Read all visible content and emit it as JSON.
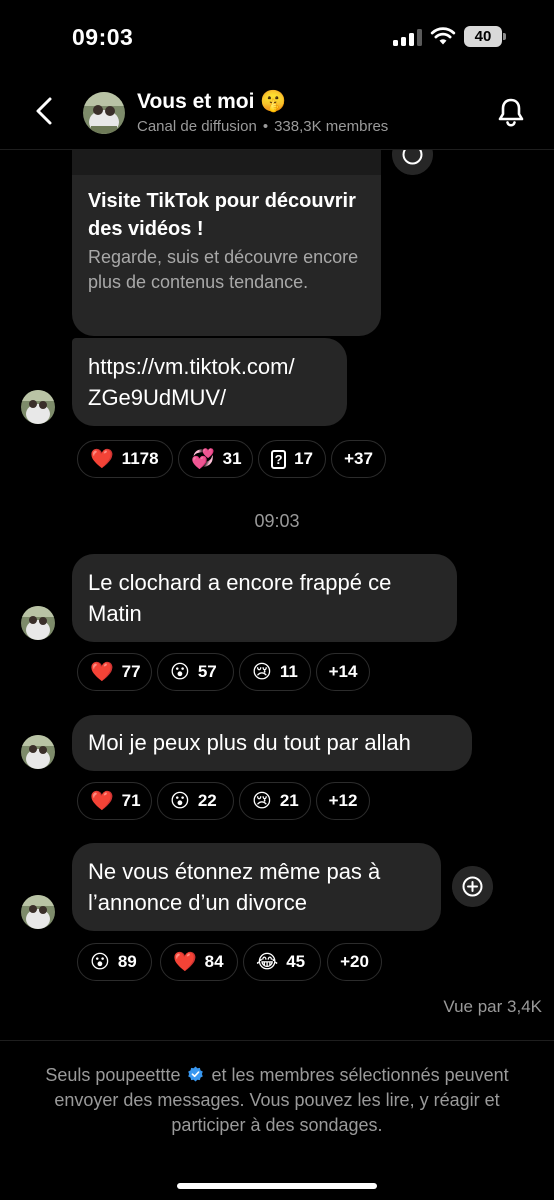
{
  "status_bar": {
    "time": "09:03",
    "battery": "40"
  },
  "header": {
    "title": "Vous et moi 🤫",
    "subtitle": "Canal de diffusion",
    "separator": "•",
    "members": "338,3K membres"
  },
  "messages": {
    "link_card": {
      "title": "Visite TikTok pour découvrir des vidéos !",
      "description": "Regarde, suis et découvre encore plus de contenus tendance."
    },
    "link": {
      "line1": "https://vm.tiktok.com/",
      "line2": "ZGe9UdMUV/"
    },
    "reactions_1": [
      {
        "emoji": "❤️",
        "count": "1178"
      },
      {
        "emoji": "💞",
        "count": "31"
      },
      {
        "emoji": "?",
        "count": "17"
      },
      {
        "label": "+37"
      }
    ],
    "timestamp": "09:03",
    "msg2": {
      "line1": "Le clochard a encore frappé ce",
      "line2": "Matin"
    },
    "reactions_2": [
      {
        "emoji": "❤️",
        "count": "77"
      },
      {
        "emoji": "😮",
        "count": "57"
      },
      {
        "emoji": "😢",
        "count": "11"
      },
      {
        "label": "+14"
      }
    ],
    "msg3": {
      "line1": "Moi je peux plus du tout par allah"
    },
    "reactions_3": [
      {
        "emoji": "❤️",
        "count": "71"
      },
      {
        "emoji": "😮",
        "count": "22"
      },
      {
        "emoji": "😢",
        "count": "21"
      },
      {
        "label": "+12"
      }
    ],
    "msg4": {
      "line1": "Ne vous étonnez même pas à",
      "line2": "l’annonce d’un divorce"
    },
    "reactions_4": [
      {
        "emoji": "😮",
        "count": "89"
      },
      {
        "emoji": "❤️",
        "count": "84"
      },
      {
        "emoji": "😂",
        "count": "45"
      },
      {
        "label": "+20"
      }
    ],
    "seen": "Vue par 3,4K"
  },
  "footer": {
    "before": "Seuls poupeettte",
    "after": "et les membres sélectionnés peuvent envoyer des messages. Vous pouvez les lire, y réagir et participer à des sondages."
  },
  "colors": {
    "background": "#000000",
    "bubble": "#262626",
    "muted": "#9a9a9a",
    "verified": "#3897f0"
  },
  "icons": [
    "back-chevron-icon",
    "bell-icon",
    "share-plus-icon",
    "verified-icon",
    "wifi-icon",
    "signal-icon",
    "battery-icon"
  ]
}
